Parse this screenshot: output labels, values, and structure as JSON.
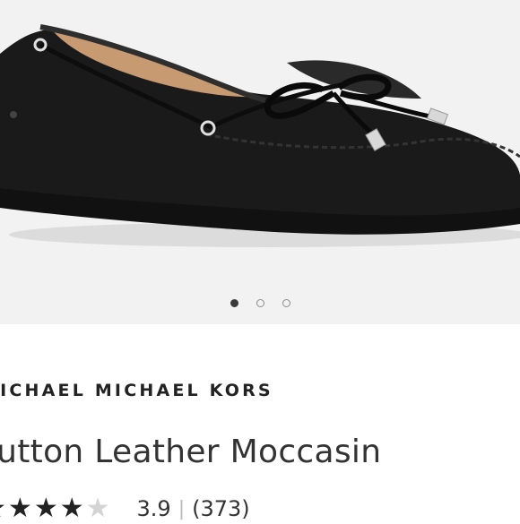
{
  "product": {
    "brand": "MICHAEL MICHAEL KORS",
    "name": "Sutton Leather Moccasin",
    "rating": 3.9,
    "rating_display": "3.9",
    "rating_max": 5,
    "reviews_display": "(373)"
  },
  "gallery": {
    "image_icon": "black-leather-moccasin-photo",
    "image_count": 3,
    "active_index": 0
  },
  "colors": {
    "gallery_background": "#f2f2f2",
    "text": "#222222",
    "star_filled": "#222222",
    "star_empty": "#d4d4d4"
  }
}
